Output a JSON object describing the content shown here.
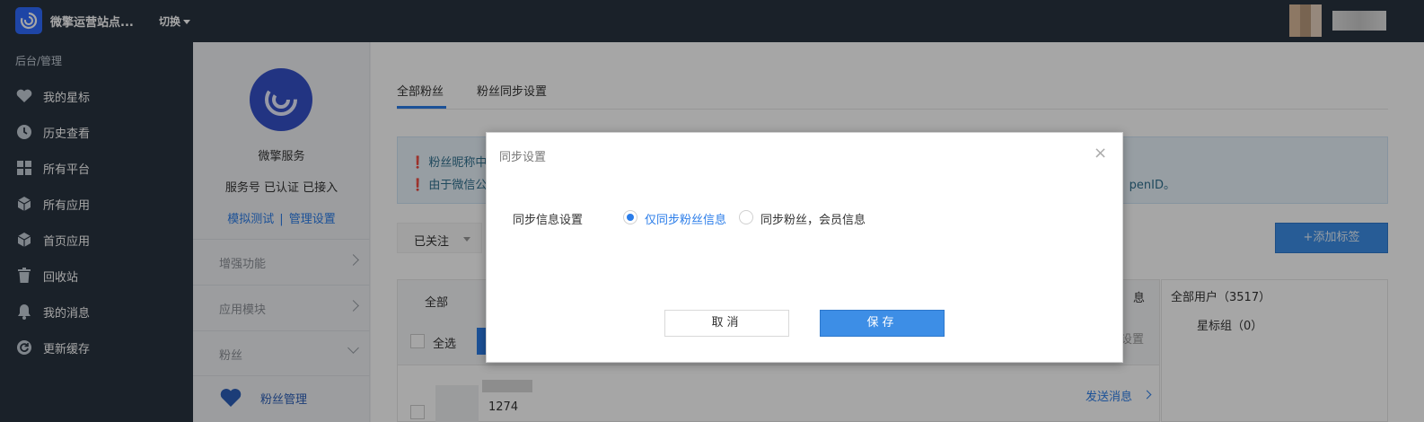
{
  "topbar": {
    "site_name": "微擎运营站点...",
    "switch_label": "切换"
  },
  "sidebar": {
    "breadcrumb": "后台/管理",
    "items": [
      {
        "label": "我的星标",
        "icon": "heart-icon"
      },
      {
        "label": "历史查看",
        "icon": "clock-icon"
      },
      {
        "label": "所有平台",
        "icon": "grid-icon"
      },
      {
        "label": "所有应用",
        "icon": "cube-icon"
      },
      {
        "label": "首页应用",
        "icon": "cube-icon"
      },
      {
        "label": "回收站",
        "icon": "trash-icon"
      },
      {
        "label": "我的消息",
        "icon": "bell-icon"
      },
      {
        "label": "更新缓存",
        "icon": "refresh-icon"
      }
    ]
  },
  "account": {
    "name": "微擎服务",
    "status": "服务号 已认证 已接入",
    "link_test": "模拟测试",
    "link_sep": "|",
    "link_manage": "管理设置",
    "sections": [
      {
        "label": "增强功能"
      },
      {
        "label": "应用模块"
      },
      {
        "label": "粉丝"
      }
    ],
    "sub_item": "粉丝管理"
  },
  "main": {
    "tabs": [
      {
        "label": "全部粉丝"
      },
      {
        "label": "粉丝同步设置"
      }
    ],
    "notice": {
      "line1": "粉丝昵称中",
      "line2": "由于微信公",
      "line2_tail": "penID。"
    },
    "filter_label": "已关注",
    "add_tag_label": "+添加标签",
    "table": {
      "all_label": "全部",
      "select_all_label": "全选",
      "col_cut": "息",
      "col_cut2": "设置"
    },
    "side_list": {
      "all_users": "全部用户（3517）",
      "star_group": "星标组（0）"
    },
    "row": {
      "id": "1274",
      "send_label": "发送消息"
    }
  },
  "modal": {
    "title": "同步设置",
    "close": "×",
    "row_label": "同步信息设置",
    "options": [
      {
        "label": "仅同步粉丝信息",
        "checked": true
      },
      {
        "label": "同步粉丝，会员信息",
        "checked": false
      }
    ],
    "cancel_label": "取消",
    "save_label": "保存"
  },
  "colors": {
    "topbar_bg": "#293340",
    "accent": "#2b7de9",
    "primary_button": "#3d8ee6"
  }
}
